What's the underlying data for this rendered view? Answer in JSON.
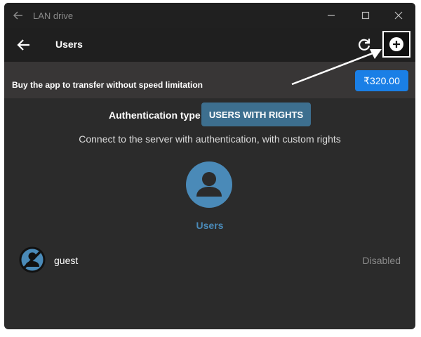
{
  "window": {
    "title": "LAN drive"
  },
  "appbar": {
    "title": "Users"
  },
  "promo": {
    "text": "Buy the app to transfer without speed limitation",
    "price": "₹320.00"
  },
  "auth": {
    "label": "Authentication type",
    "value": "USERS WITH RIGHTS",
    "description": "Connect to the server with authentication, with custom rights"
  },
  "users_section": {
    "label": "Users"
  },
  "users": [
    {
      "name": "guest",
      "status": "Disabled"
    }
  ],
  "colors": {
    "accent": "#1a7fe6",
    "auth_button": "#3d6f8f",
    "users_blue": "#4a8ab8",
    "background": "#2b2b2b"
  },
  "icons": [
    "back-arrow-icon",
    "minimize-icon",
    "maximize-icon",
    "close-icon",
    "refresh-icon",
    "add-circle-icon",
    "user-group-icon",
    "user-disabled-icon"
  ]
}
